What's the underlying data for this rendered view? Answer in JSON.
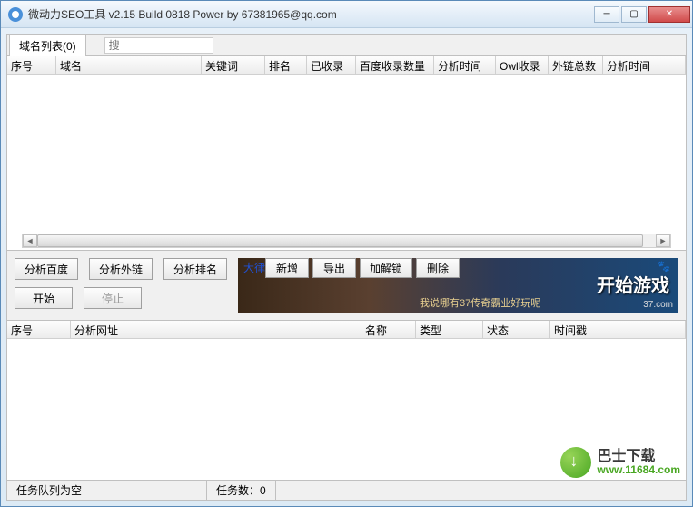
{
  "window": {
    "title": "微动力SEO工具 v2.15 Build 0818 Power by 67381965@qq.com"
  },
  "top": {
    "tab_label": "域名列表(0)",
    "search_placeholder": "搜",
    "columns": [
      "序号",
      "域名",
      "关键词",
      "排名",
      "已收录",
      "百度收录数量",
      "分析时间",
      "Owl收录",
      "外链总数",
      "分析时间"
    ]
  },
  "mid": {
    "analyze_baidu": "分析百度",
    "analyze_links": "分析外链",
    "analyze_rank": "分析排名",
    "start": "开始",
    "stop": "停止",
    "banner_link": "大律师",
    "add": "新增",
    "export": "导出",
    "lock": "加解锁",
    "del": "删除",
    "banner_main": "开始游戏",
    "banner_sub": "我说哪有37传奇霸业好玩呢",
    "banner_corner": "37.com"
  },
  "bottom": {
    "columns": [
      "序号",
      "分析网址",
      "名称",
      "类型",
      "状态",
      "时间戳"
    ]
  },
  "status": {
    "queue": "任务队列为空",
    "count": "任务数：0"
  },
  "watermark": {
    "cn": "巴士下载",
    "url": "www.11684.com"
  }
}
